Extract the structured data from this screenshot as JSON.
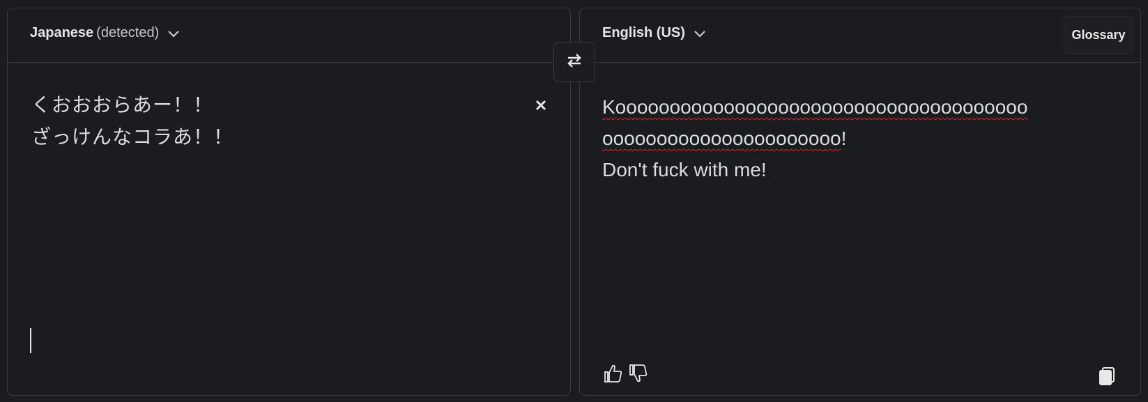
{
  "source_panel": {
    "language_name": "Japanese",
    "language_detected": "(detected)",
    "text_line1": "くおおおらあー！！",
    "text_line2": "ざっけんなコラあ！！",
    "chevron_icon": "chevron-down-icon",
    "clear_icon": "close-icon"
  },
  "swap": {
    "icon": "swap-arrows-icon"
  },
  "target_panel": {
    "language_name": "English (US)",
    "glossary_label": "Glossary",
    "text_line1": "Koooooooooooooooooooooooooooooooooooooo",
    "text_line2_misspelled": "oooooooooooooooooooooo",
    "text_line2_punct": "!",
    "text_line3": "Don't fuck with me!",
    "feedback_icons": [
      "thumbs-up-icon",
      "thumbs-down-icon"
    ],
    "copy_icon": "copy-icon"
  },
  "colors": {
    "background": "#1b1c1f",
    "border": "#3a3b3f",
    "text": "#dcdcdc",
    "spellcheck": "#e02020"
  }
}
